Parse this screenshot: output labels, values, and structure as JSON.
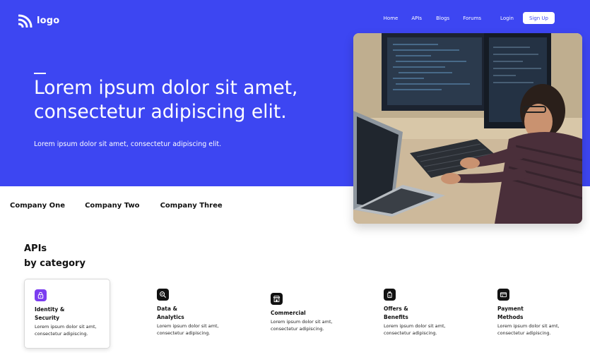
{
  "header": {
    "logo_text": "logo",
    "nav": [
      "Home",
      "APIs",
      "Blogs",
      "Forums",
      "Login"
    ],
    "signup_label": "Sign Up"
  },
  "hero": {
    "title_line1": "Lorem ipsum dolor sit amet,",
    "title_line2": "consectetur adipiscing elit.",
    "subtitle": "Lorem ipsum dolor sit amet, consectetur adipiscing elit."
  },
  "companies": [
    "Company One",
    "Company Two",
    "Company Three"
  ],
  "apis": {
    "title_line1": "APIs",
    "title_line2": "by category",
    "cards": [
      {
        "title_line1": "Identity &",
        "title_line2": "Security",
        "desc_line1": "Lorem ipsum dolor sit amt,",
        "desc_line2": "consectetur adipiscing.",
        "icon": "lock-icon"
      },
      {
        "title_line1": "Data &",
        "title_line2": "Analytics",
        "desc_line1": "Lorem ipsum dolor sit amt,",
        "desc_line2": "consectetur adipiscing.",
        "icon": "analytics-search-icon"
      },
      {
        "title_line1": "Commercial",
        "title_line2": "",
        "desc_line1": "Lorem ipsum dolor sit amt,",
        "desc_line2": "consectetur adipiscing.",
        "icon": "store-icon"
      },
      {
        "title_line1": "Offers &",
        "title_line2": "Benefits",
        "desc_line1": "Lorem ipsum dolor sit amt,",
        "desc_line2": "consectetur adipiscing.",
        "icon": "gift-icon"
      },
      {
        "title_line1": "Payment",
        "title_line2": "Methods",
        "desc_line1": "Lorem ipsum dolor sit amt,",
        "desc_line2": "consectetur adipiscing.",
        "icon": "card-payment-icon"
      }
    ]
  },
  "colors": {
    "brand_blue": "#3d46f2",
    "accent_purple": "#7b3df0"
  }
}
